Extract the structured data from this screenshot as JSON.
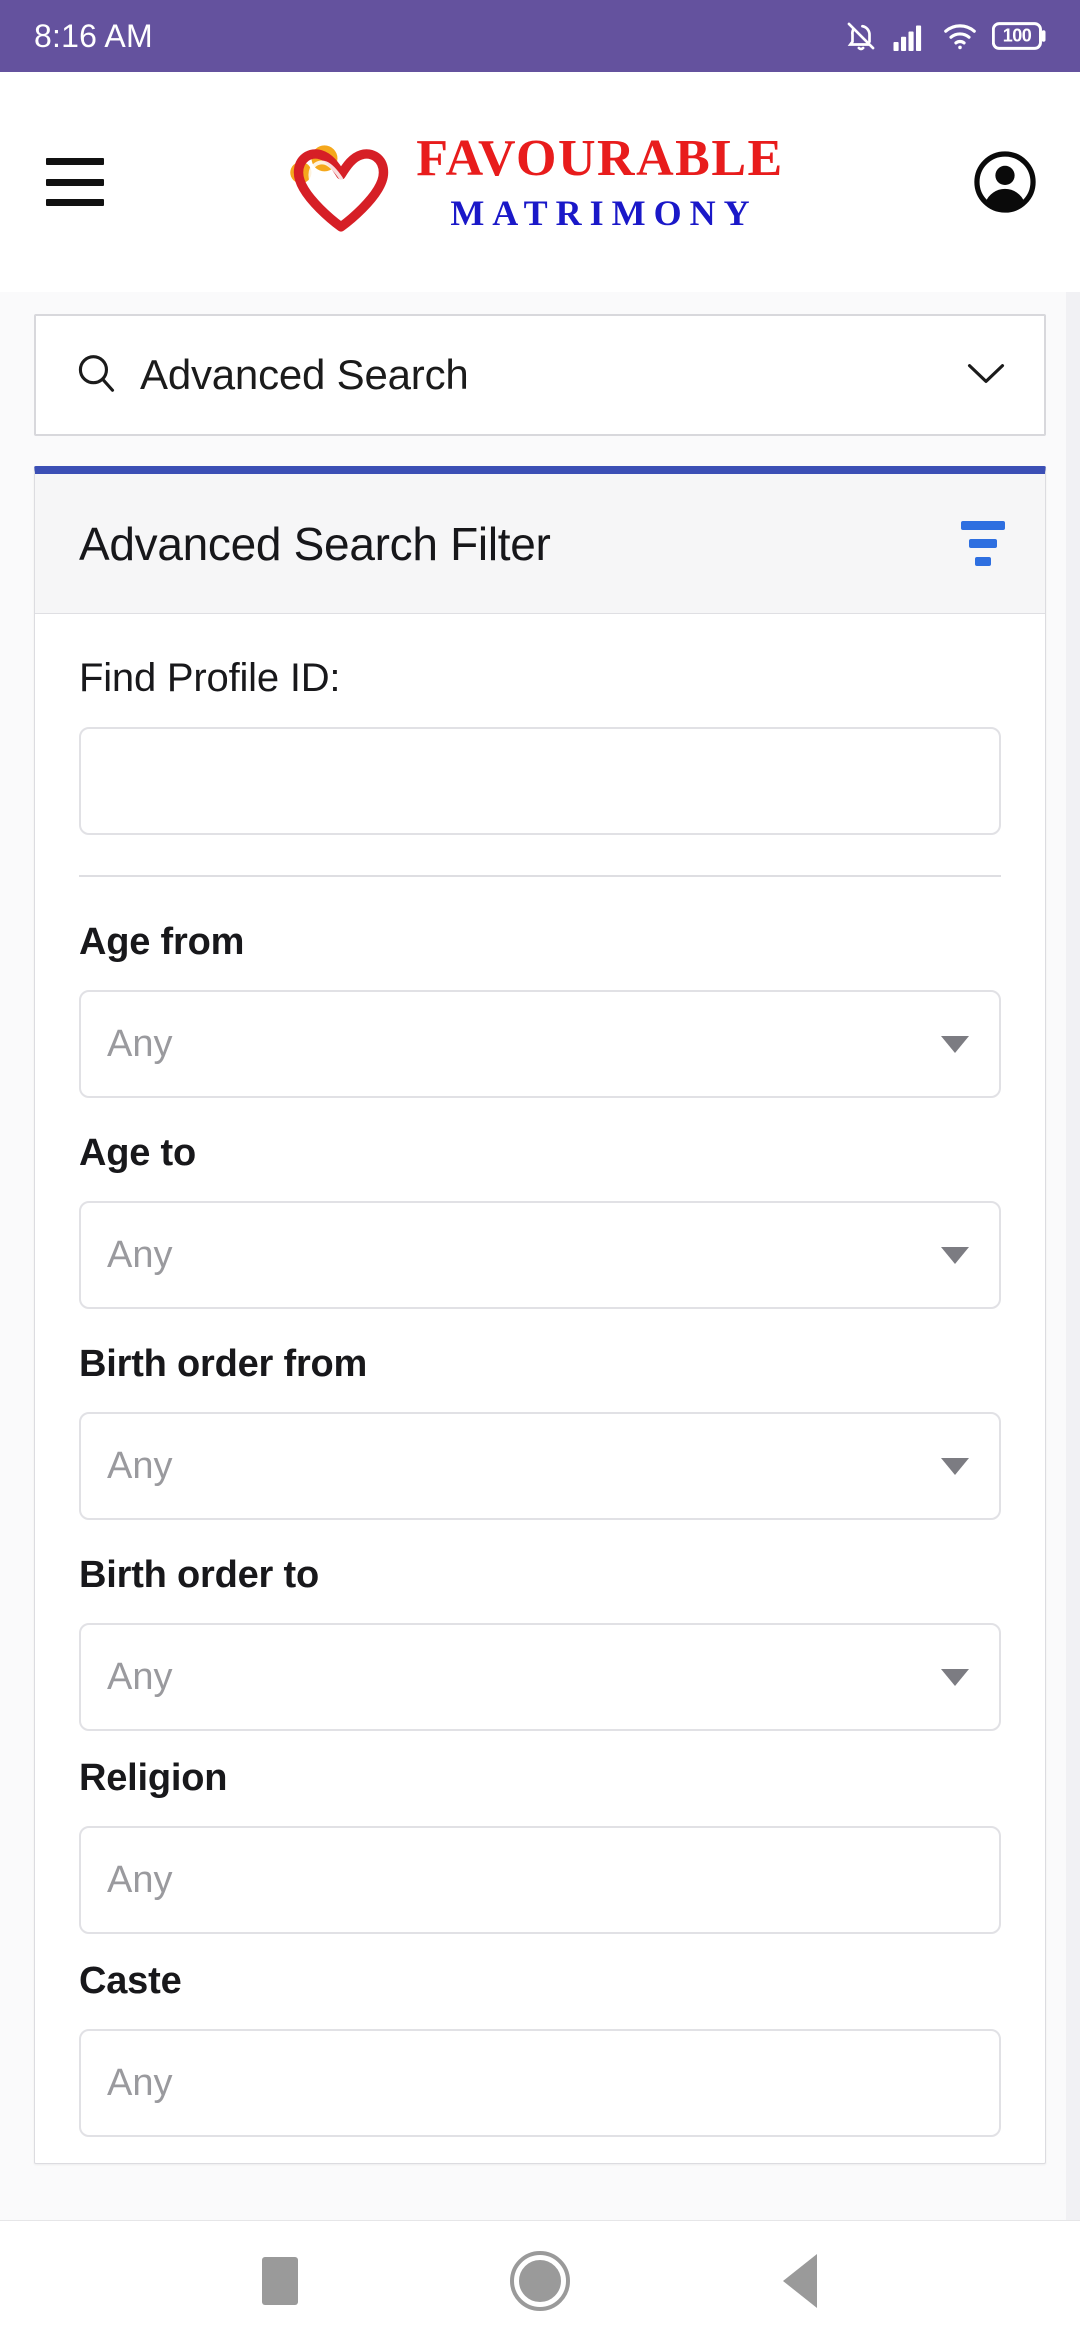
{
  "status_bar": {
    "time": "8:16 AM",
    "battery_level": "100",
    "icons": [
      "notifications-muted-icon",
      "signal-bars-icon",
      "wifi-icon",
      "battery-icon"
    ],
    "background_color": "#64529E"
  },
  "header": {
    "menu_icon": "hamburger-menu-icon",
    "logo_top_text": "FAVOURABLE",
    "logo_bottom_text": "MATRIMONY",
    "logo_top_color": "#E81C1C",
    "logo_bottom_color": "#1A18C8",
    "account_icon": "account-circle-icon"
  },
  "search_bar": {
    "label": "Advanced Search",
    "search_icon": "search-icon",
    "expand_icon": "chevron-down-icon"
  },
  "filter_card": {
    "title": "Advanced Search Filter",
    "filter_icon": "filter-lines-icon",
    "accent_top_color": "#3B4FB5",
    "filter_icon_color": "#2E6FE0",
    "profile_id": {
      "label": "Find Profile ID:",
      "value": "",
      "placeholder": ""
    },
    "fields": [
      {
        "label": "Age from",
        "type": "select",
        "value": "Any",
        "placeholder": "Any"
      },
      {
        "label": "Age to",
        "type": "select",
        "value": "Any",
        "placeholder": "Any"
      },
      {
        "label": "Birth order from",
        "type": "select",
        "value": "Any",
        "placeholder": "Any"
      },
      {
        "label": "Birth order to",
        "type": "select",
        "value": "Any",
        "placeholder": "Any"
      },
      {
        "label": "Religion",
        "type": "text",
        "value": "",
        "placeholder": "Any"
      },
      {
        "label": "Caste",
        "type": "text",
        "value": "",
        "placeholder": "Any"
      }
    ]
  },
  "nav_bar": {
    "recents_label": "Recents",
    "home_label": "Home",
    "back_label": "Back"
  }
}
